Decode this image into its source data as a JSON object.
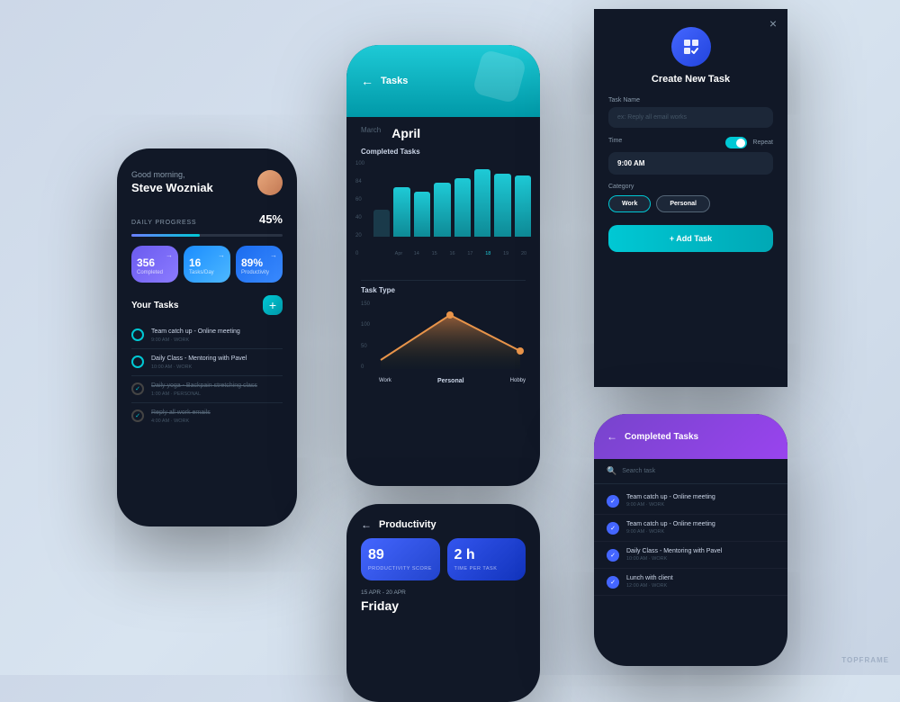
{
  "phone1": {
    "greeting": "Good morning,",
    "name": "Steve Wozniak",
    "progress_label": "DAILY PROGRESS",
    "progress_pct": "45%",
    "stats": [
      {
        "value": "356",
        "label": "Completed"
      },
      {
        "value": "16",
        "label": "Tasks/Day"
      },
      {
        "value": "89%",
        "label": "Productivity"
      }
    ],
    "tasks_title": "Your Tasks",
    "add_btn": "+",
    "tasks": [
      {
        "name": "Team catch up - Online meeting",
        "time": "9:00 AM",
        "category": "WORK",
        "done": false
      },
      {
        "name": "Daily Class - Mentoring with Pavel",
        "time": "10:00 AM",
        "category": "WORK",
        "done": false
      },
      {
        "name": "Daily yoga - Backpain stretching class",
        "time": "1:00 AM",
        "category": "PERSONAL",
        "done": true
      },
      {
        "name": "Reply all work emails",
        "time": "4:00 AM",
        "category": "WORK",
        "done": true
      }
    ]
  },
  "phone2": {
    "back": "←",
    "title": "Tasks",
    "months": [
      "March",
      "April"
    ],
    "active_month": "April",
    "completed_title": "Completed Tasks",
    "bar_max_label": "100",
    "bar_84_label": "84",
    "bar_60_label": "60",
    "bar_40_label": "40",
    "bar_20_label": "20",
    "bar_0_label": "0",
    "x_labels": [
      "April",
      "14",
      "15",
      "16",
      "17",
      "18",
      "19",
      "20"
    ],
    "task_type_title": "Task Type",
    "y2_labels": [
      "150",
      "100",
      "50",
      "0"
    ],
    "x2_labels": [
      "Work",
      "Personal",
      "Hobby"
    ]
  },
  "phone3": {
    "close": "×",
    "title": "Create New Task",
    "task_name_label": "Task Name",
    "task_name_placeholder": "ex: Reply all email works",
    "time_label": "Time",
    "repeat_label": "Repeat",
    "time_value": "9:00 AM",
    "category_label": "Category",
    "category_work": "Work",
    "category_personal": "Personal",
    "add_btn": "+ Add Task"
  },
  "phone4": {
    "back": "←",
    "title": "Productivity",
    "score_value": "89",
    "score_label": "PRODUCTIVITY SCORE",
    "time_value": "2 h",
    "time_label": "TIME PER TASK",
    "date_range": "15 APR - 20 APR",
    "day_title": "Friday"
  },
  "phone5": {
    "back": "←",
    "title": "Completed Tasks",
    "search_placeholder": "Search task",
    "tasks": [
      {
        "name": "Team catch up - Online meeting",
        "time": "9:00 AM",
        "category": "WORK"
      },
      {
        "name": "Team catch up - Online meeting",
        "time": "9:00 AM",
        "category": "WORK"
      },
      {
        "name": "Daily Class - Mentoring with Pavel",
        "time": "10:00 AM",
        "category": "WORK"
      },
      {
        "name": "Lunch with client",
        "time": "12:00 AM",
        "category": "WORK"
      }
    ]
  },
  "watermark": "TOPFRAME"
}
